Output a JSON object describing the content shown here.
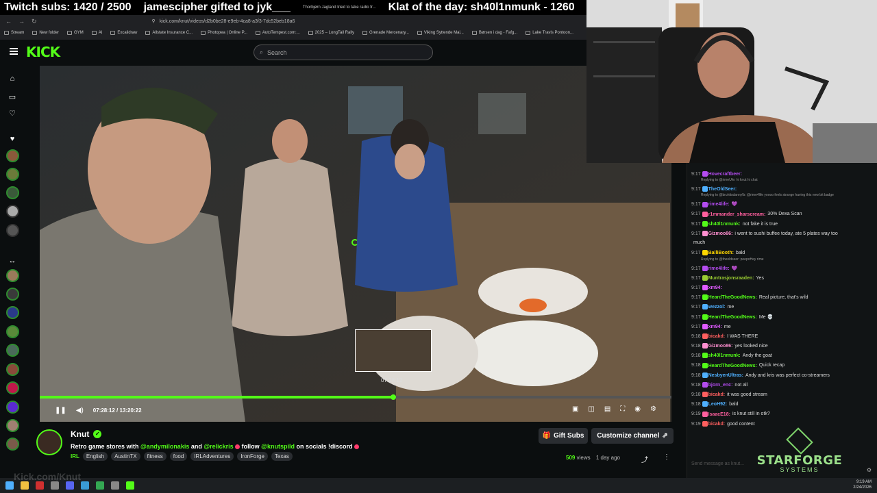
{
  "overlay": {
    "subs": "Twitch subs: 1420 / 2500",
    "gifter": "jamescipher gifted to jyk___",
    "tab_text": "Thorbjørn Jagland tried to take radio fr...",
    "klat": "Klat of the day: sh40l1nmunk - 1260"
  },
  "browser": {
    "url": "kick.com/knut/videos/d2b0be28-e9eb-4ca8-a3f3-7dc52beb18a6",
    "bookmarks": [
      "Stream",
      "New folder",
      "GYM",
      "AI",
      "Excalidraw",
      "Allstate Insurance C...",
      "Photopea | Online P...",
      "AutoTempest.com:...",
      "2025 – LongTail Rally",
      "Grenade Mercenary...",
      "Viking Syttende Mai...",
      "Børsen i dag - Fafg...",
      "Lake Travis Pontoon..."
    ]
  },
  "kick": {
    "logo": "KICK",
    "search_placeholder": "Search",
    "player": {
      "current_time": "07:28:12",
      "total_time": "13:20:22",
      "time_display": "07:28:12 / 13:20:22",
      "progress": 0.56,
      "preview_time": "07:28:12"
    },
    "channel": {
      "name": "Knut",
      "title_pre": "Retro game stores with ",
      "mention1": "@andymilonakis",
      "and": " and ",
      "mention2": "@relickris",
      "follow": " follow ",
      "mention3": "@knutspild",
      "title_post": " on socials !discord",
      "category": "IRL",
      "tags": [
        "English",
        "AustinTX",
        "fitness",
        "food",
        "IRLAdventures",
        "IronForge",
        "Texas"
      ],
      "gift_subs": "Gift Subs",
      "customize": "Customize channel",
      "views_count": "509",
      "views_label": "views",
      "ago": "1 day ago"
    }
  },
  "chat": {
    "messages": [
      {
        "time": "9:17",
        "user": "Hovecraftbeer:",
        "color": "#b44cf0",
        "text": ""
      },
      {
        "reply": "Replying to @rimeUfe: hi knut hi chat"
      },
      {
        "time": "9:17",
        "user": "TheOldSeer:",
        "color": "#4fb0ff",
        "text": ""
      },
      {
        "reply": "Replying to @bruhitsdanny!b: @rime4life yoooo feels strange having this new bit badge"
      },
      {
        "time": "9:17",
        "user": "rime4life:",
        "color": "#b44cf0",
        "text": "💜"
      },
      {
        "time": "9:17",
        "user": "r1mmander_sharscream:",
        "color": "#ff5f9e",
        "text": "30% Dexa Scan"
      },
      {
        "time": "9:17",
        "user": "sh40l1nmunk:",
        "color": "#53fc18",
        "text": "not fake it is true"
      },
      {
        "time": "9:17",
        "user": "Gizmoo86:",
        "color": "#ff8fd0",
        "text": "i went to sushi buffee today, ate 5 plates way too"
      },
      {
        "time": "",
        "user": "",
        "color": "#ddd",
        "text": "much"
      },
      {
        "time": "9:17",
        "user": "BalliBooth:",
        "color": "#ffd700",
        "text": "bald"
      },
      {
        "reply": "Replying to @theoldseer: peepoHey rime"
      },
      {
        "time": "9:17",
        "user": "rime4life:",
        "color": "#b44cf0",
        "text": "💜"
      },
      {
        "time": "9:17",
        "user": "Muntrasjonsraaden:",
        "color": "#9acd32",
        "text": "Yes"
      },
      {
        "time": "9:17",
        "user": "xm94:",
        "color": "#e05aff",
        "text": ""
      },
      {
        "time": "9:17",
        "user": "HeardTheGoodNews:",
        "color": "#53fc18",
        "text": "Real picture, that's wild"
      },
      {
        "time": "9:17",
        "user": "wezzol:",
        "color": "#4fb0ff",
        "text": "me"
      },
      {
        "time": "9:17",
        "user": "HeardTheGoodNews:",
        "color": "#53fc18",
        "text": "Me 💀"
      },
      {
        "time": "9:17",
        "user": "xm94:",
        "color": "#e05aff",
        "text": "me"
      },
      {
        "time": "9:18",
        "user": "bicakd:",
        "color": "#ff5f5f",
        "text": "I WAS THERE"
      },
      {
        "time": "9:18",
        "user": "Gizmoo86:",
        "color": "#ff8fd0",
        "text": "yes looked nice"
      },
      {
        "time": "9:18",
        "user": "sh40l1nmunk:",
        "color": "#53fc18",
        "text": "Andy the goat"
      },
      {
        "time": "9:18",
        "user": "HeardTheGoodNews:",
        "color": "#53fc18",
        "text": "Quick recap"
      },
      {
        "time": "9:18",
        "user": "NesbyenUltras:",
        "color": "#4fb0ff",
        "text": "Andy and kris was perfect co-streamers"
      },
      {
        "time": "9:18",
        "user": "bjorn_enc:",
        "color": "#b44cf0",
        "text": "not all"
      },
      {
        "time": "9:18",
        "user": "bicakd:",
        "color": "#ff5f5f",
        "text": "it was good stream"
      },
      {
        "time": "9:18",
        "user": "LeoH92:",
        "color": "#4fb0ff",
        "text": "bald"
      },
      {
        "time": "9:19",
        "user": "IsaacE18:",
        "color": "#ff5f9e",
        "text": "is knut still in otk?"
      },
      {
        "time": "9:19",
        "user": "bicakd:",
        "color": "#ff5f5f",
        "text": "good content"
      }
    ],
    "input_placeholder": "Send message as knut...",
    "brand": "STARFORGE",
    "brand_sub": "SYSTEMS"
  },
  "taskbar": {
    "time": "9:19 AM",
    "date": "2/24/2026"
  },
  "watermark": "Kick.com/Knut",
  "colors": {
    "accent": "#53fc18",
    "bg": "#0b0e0f"
  }
}
